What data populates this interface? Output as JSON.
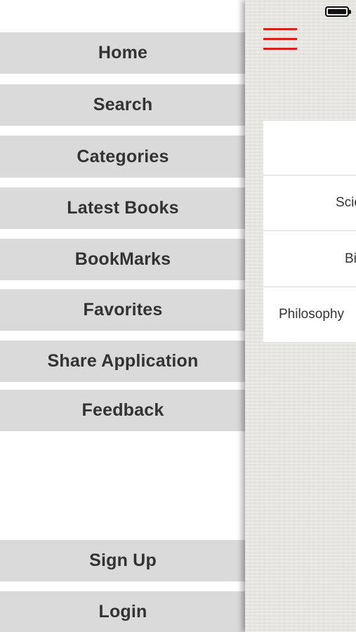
{
  "menu": {
    "items": [
      {
        "label": "Home"
      },
      {
        "label": "Search"
      },
      {
        "label": "Categories"
      },
      {
        "label": "Latest Books"
      },
      {
        "label": "BookMarks"
      },
      {
        "label": "Favorites"
      },
      {
        "label": "Share Application"
      },
      {
        "label": "Feedback"
      }
    ],
    "bottom_items": [
      {
        "label": "Sign Up"
      },
      {
        "label": "Login"
      }
    ]
  },
  "main": {
    "menu_icon": "hamburger-icon",
    "menu_icon_color": "#d6221e",
    "list": [
      {
        "label": ""
      },
      {
        "label": "Scie"
      },
      {
        "label": "Bi"
      },
      {
        "label": "Philosophy"
      }
    ]
  },
  "status_bar": {
    "battery_icon": "battery-icon"
  }
}
